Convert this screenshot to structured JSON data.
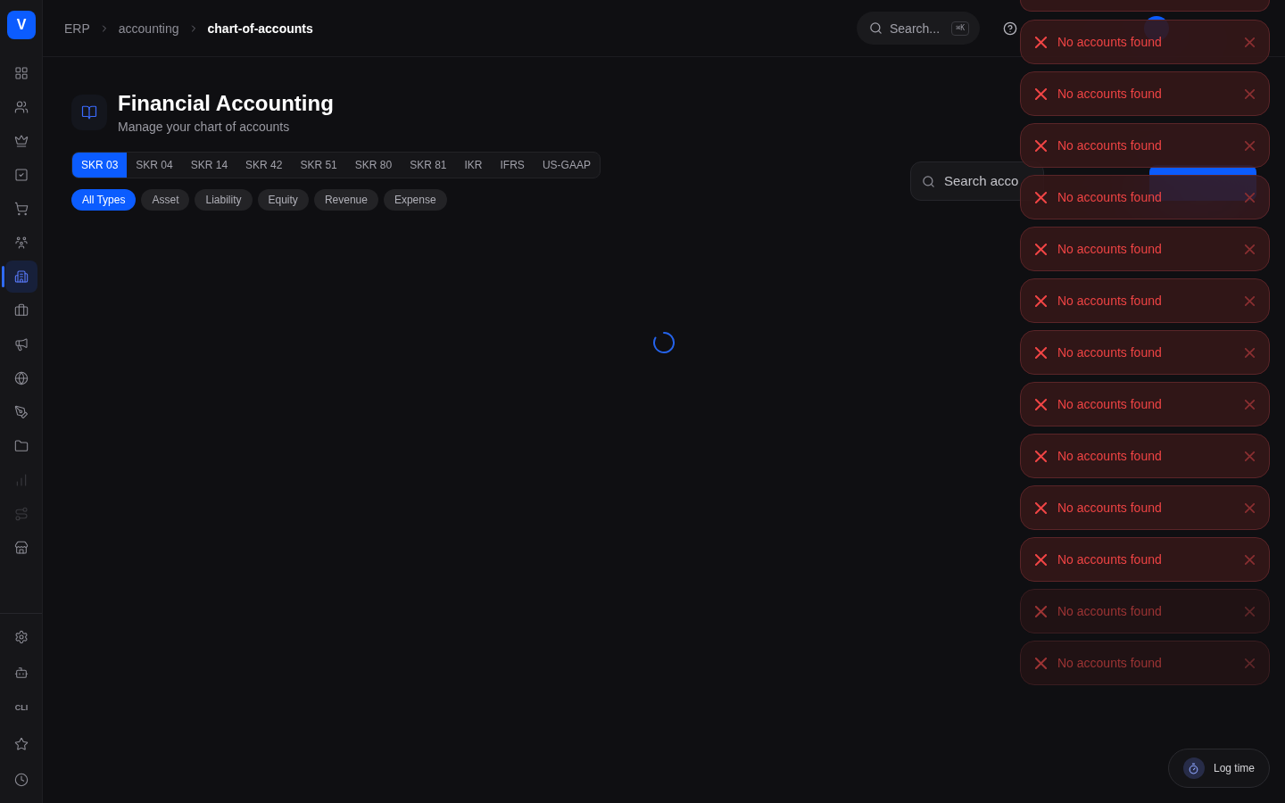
{
  "sidebar": {
    "logo": "V",
    "items": [
      {
        "selected": false,
        "disabled": false
      },
      {
        "selected": false,
        "disabled": false
      },
      {
        "selected": false,
        "disabled": false
      },
      {
        "selected": false,
        "disabled": false
      },
      {
        "selected": false,
        "disabled": false
      },
      {
        "selected": false,
        "disabled": false
      },
      {
        "selected": true,
        "disabled": false
      },
      {
        "selected": false,
        "disabled": false
      },
      {
        "selected": false,
        "disabled": false
      },
      {
        "selected": false,
        "disabled": false
      },
      {
        "selected": false,
        "disabled": false
      },
      {
        "selected": false,
        "disabled": false
      },
      {
        "selected": false,
        "disabled": true
      },
      {
        "selected": false,
        "disabled": true
      },
      {
        "selected": false,
        "disabled": false
      }
    ],
    "footer_items": [
      {
        "kind": "icon"
      },
      {
        "kind": "icon"
      },
      {
        "kind": "text",
        "label": "CLI"
      },
      {
        "kind": "icon"
      },
      {
        "kind": "icon"
      }
    ]
  },
  "breadcrumb": [
    {
      "label": "ERP",
      "current": false
    },
    {
      "label": "accounting",
      "current": false
    },
    {
      "label": "chart-of-accounts",
      "current": true
    }
  ],
  "header": {
    "search": {
      "label": "Search...",
      "shortcut": "⌘K"
    }
  },
  "page": {
    "title": "Financial Accounting",
    "subtitle": "Manage your chart of accounts"
  },
  "charts_of_accounts": [
    {
      "label": "SKR 03",
      "selected": true
    },
    {
      "label": "SKR 04",
      "selected": false
    },
    {
      "label": "SKR 14",
      "selected": false
    },
    {
      "label": "SKR 42",
      "selected": false
    },
    {
      "label": "SKR 51",
      "selected": false
    },
    {
      "label": "SKR 80",
      "selected": false
    },
    {
      "label": "SKR 81",
      "selected": false
    },
    {
      "label": "IKR",
      "selected": false
    },
    {
      "label": "IFRS",
      "selected": false
    },
    {
      "label": "US-GAAP",
      "selected": false
    }
  ],
  "type_filters": [
    {
      "label": "All Types",
      "selected": true
    },
    {
      "label": "Asset",
      "selected": false
    },
    {
      "label": "Liability",
      "selected": false
    },
    {
      "label": "Equity",
      "selected": false
    },
    {
      "label": "Revenue",
      "selected": false
    },
    {
      "label": "Expense",
      "selected": false
    }
  ],
  "account_search": {
    "placeholder": "Search acco"
  },
  "loading": true,
  "toasts": [
    {
      "message": "No accounts found",
      "faded": false
    },
    {
      "message": "No accounts found",
      "faded": false
    },
    {
      "message": "No accounts found",
      "faded": false
    },
    {
      "message": "No accounts found",
      "faded": false
    },
    {
      "message": "No accounts found",
      "faded": false
    },
    {
      "message": "No accounts found",
      "faded": false
    },
    {
      "message": "No accounts found",
      "faded": false
    },
    {
      "message": "No accounts found",
      "faded": false
    },
    {
      "message": "No accounts found",
      "faded": false
    },
    {
      "message": "No accounts found",
      "faded": false
    },
    {
      "message": "No accounts found",
      "faded": false
    },
    {
      "message": "No accounts found",
      "faded": true
    },
    {
      "message": "No accounts found",
      "faded": true
    }
  ],
  "log_time_button": {
    "label": "Log time"
  }
}
